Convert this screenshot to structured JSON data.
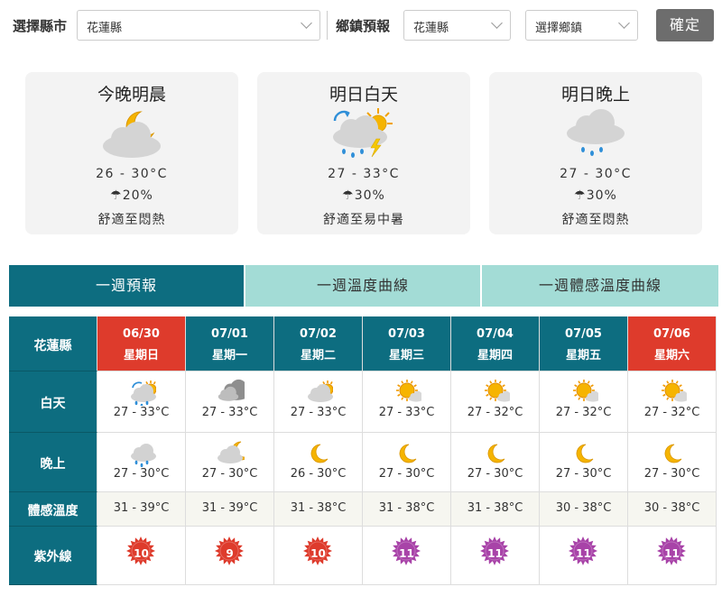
{
  "selector": {
    "county_label": "選擇縣市",
    "county_value": "花蓮縣",
    "town_label": "鄉鎮預報",
    "town_county_value": "花蓮縣",
    "town_value": "選擇鄉鎮",
    "confirm_label": "確定"
  },
  "cards": [
    {
      "title": "今晚明晨",
      "icon": "cloudy-night-icon",
      "temp": "26 - 30°C",
      "rain": "20%",
      "feel": "舒適至悶熱"
    },
    {
      "title": "明日白天",
      "icon": "thunder-shower-icon",
      "temp": "27 - 33°C",
      "rain": "30%",
      "feel": "舒適至易中暑"
    },
    {
      "title": "明日晚上",
      "icon": "shower-icon",
      "temp": "27 - 30°C",
      "rain": "30%",
      "feel": "舒適至悶熱"
    }
  ],
  "tabs": [
    "一週預報",
    "一週溫度曲線",
    "一週體感溫度曲線"
  ],
  "week": {
    "county": "花蓮縣",
    "row_labels": {
      "day": "白天",
      "night": "晚上",
      "feel": "體感溫度",
      "uv": "紫外線"
    },
    "days": [
      {
        "date": "06/30",
        "weekday": "星期日",
        "header_color": "#de3b2c",
        "day_icon": "partly-sunny-rain-icon",
        "day_temp": "27 - 33°C",
        "night_icon": "cloudy-rain-icon",
        "night_temp": "27 - 30°C",
        "feel": "31 - 39°C",
        "uv": "10",
        "uv_color": "#de3b2c"
      },
      {
        "date": "07/01",
        "weekday": "星期一",
        "header_color": "#0d6d80",
        "day_icon": "cloudy-icon",
        "day_temp": "27 - 33°C",
        "night_icon": "cloudy-moon-icon",
        "night_temp": "27 - 30°C",
        "feel": "31 - 39°C",
        "uv": "9",
        "uv_color": "#de3b2c"
      },
      {
        "date": "07/02",
        "weekday": "星期二",
        "header_color": "#0d6d80",
        "day_icon": "partly-sunny-icon",
        "day_temp": "27 - 33°C",
        "night_icon": "moon-icon",
        "night_temp": "26 - 30°C",
        "feel": "31 - 38°C",
        "uv": "10",
        "uv_color": "#de3b2c"
      },
      {
        "date": "07/03",
        "weekday": "星期三",
        "header_color": "#0d6d80",
        "day_icon": "sunny-cloud-icon",
        "day_temp": "27 - 33°C",
        "night_icon": "moon-icon",
        "night_temp": "27 - 30°C",
        "feel": "31 - 38°C",
        "uv": "11",
        "uv_color": "#a843a8"
      },
      {
        "date": "07/04",
        "weekday": "星期四",
        "header_color": "#0d6d80",
        "day_icon": "sunny-cloud-icon",
        "day_temp": "27 - 32°C",
        "night_icon": "moon-icon",
        "night_temp": "27 - 30°C",
        "feel": "31 - 38°C",
        "uv": "11",
        "uv_color": "#a843a8"
      },
      {
        "date": "07/05",
        "weekday": "星期五",
        "header_color": "#0d6d80",
        "day_icon": "sunny-cloud-icon",
        "day_temp": "27 - 32°C",
        "night_icon": "moon-icon",
        "night_temp": "27 - 30°C",
        "feel": "30 - 38°C",
        "uv": "11",
        "uv_color": "#a843a8"
      },
      {
        "date": "07/06",
        "weekday": "星期六",
        "header_color": "#de3b2c",
        "day_icon": "sunny-cloud-icon",
        "day_temp": "27 - 32°C",
        "night_icon": "moon-icon",
        "night_temp": "27 - 30°C",
        "feel": "30 - 38°C",
        "uv": "11",
        "uv_color": "#a843a8"
      }
    ]
  }
}
